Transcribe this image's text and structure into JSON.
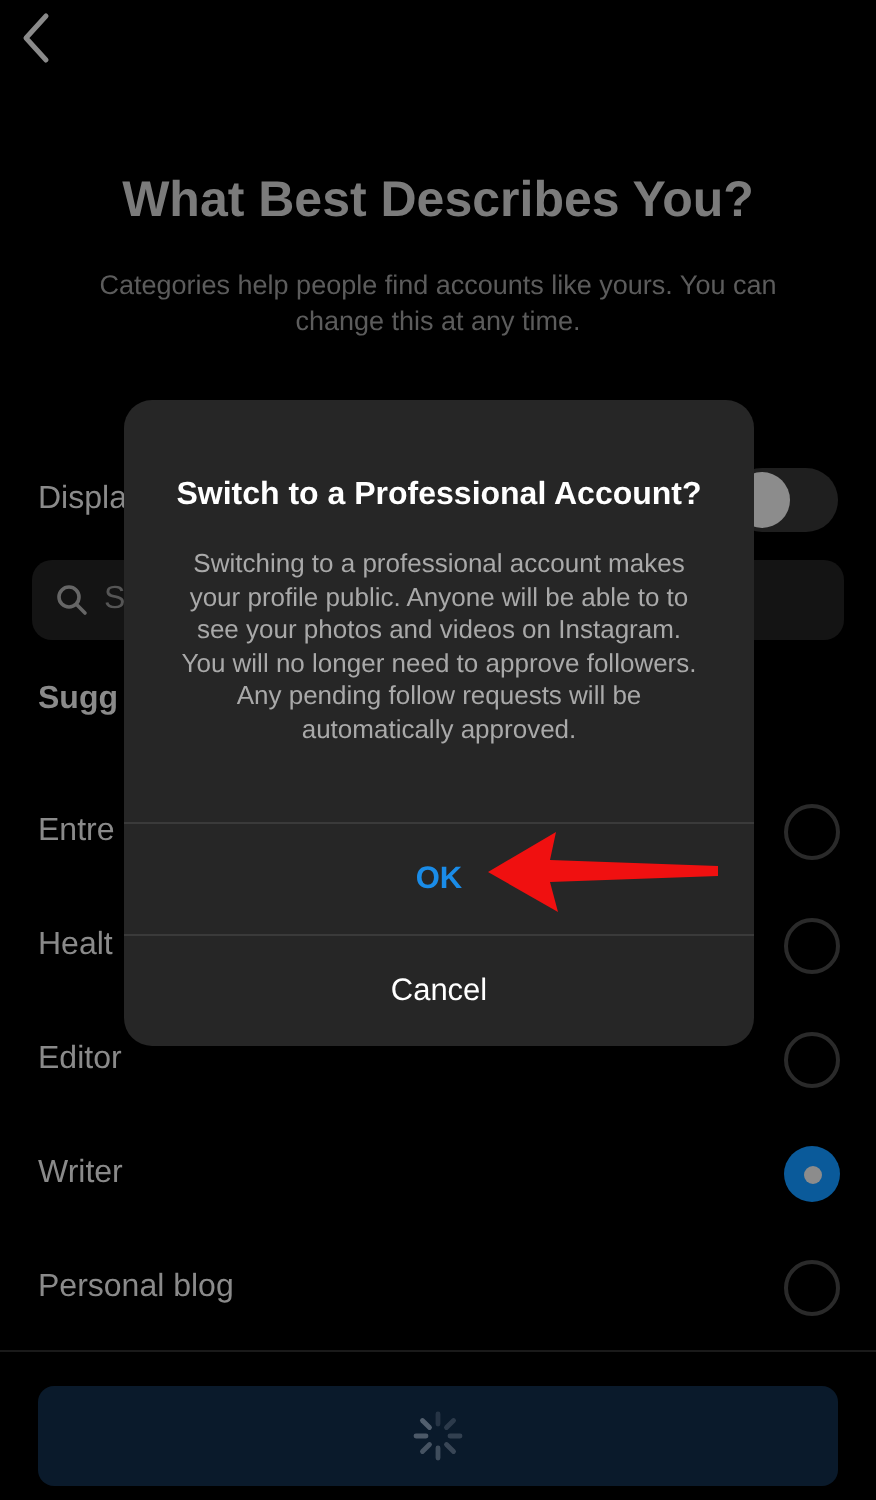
{
  "title": "What Best Describes You?",
  "subtitle": "Categories help people find accounts like yours. You can change this at any time.",
  "display_toggle": {
    "label": "Displa",
    "on": false
  },
  "search": {
    "placeholder": "S"
  },
  "section_label": "Sugg",
  "categories": [
    {
      "name": "Entre",
      "selected": false
    },
    {
      "name": "Healt",
      "selected": false
    },
    {
      "name": "Editor",
      "selected": false
    },
    {
      "name": "Writer",
      "selected": true
    },
    {
      "name": "Personal blog",
      "selected": false
    }
  ],
  "primary_button": {
    "loading": true
  },
  "dialog": {
    "title": "Switch to a Professional Account?",
    "message": "Switching to a professional account makes your profile public. Anyone will be able to to see your photos and videos on Instagram. You will no longer need to approve followers. Any pending follow requests will be automatically approved.",
    "buttons": [
      {
        "label": "OK",
        "kind": "primary"
      },
      {
        "label": "Cancel",
        "kind": "default"
      }
    ]
  }
}
